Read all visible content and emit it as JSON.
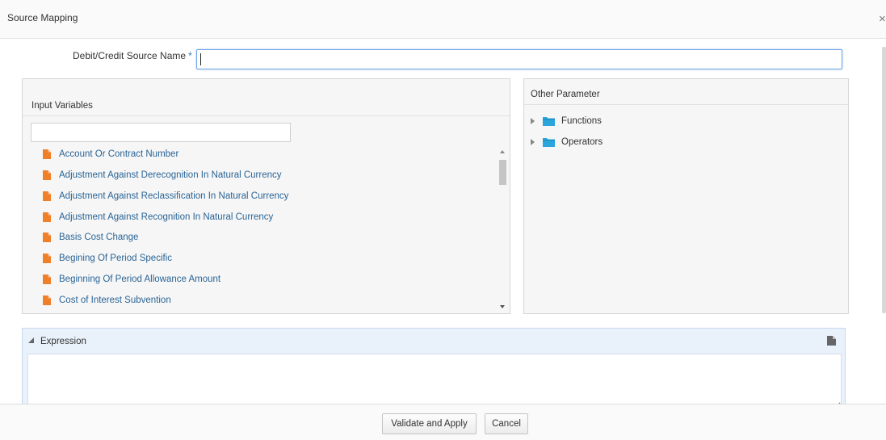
{
  "dialog": {
    "title": "Source Mapping",
    "close_glyph": "×"
  },
  "form": {
    "name_label": "Debit/Credit Source Name",
    "required_marker": "*",
    "name_value": ""
  },
  "input_variables": {
    "title": "Input Variables",
    "search_placeholder": "",
    "items": [
      {
        "label": "Account Or Contract Number",
        "icon": "file-icon"
      },
      {
        "label": "Adjustment Against Derecognition In Natural Currency",
        "icon": "file-icon"
      },
      {
        "label": "Adjustment Against Reclassification In Natural Currency",
        "icon": "file-icon"
      },
      {
        "label": "Adjustment Against Recognition In Natural Currency",
        "icon": "file-icon"
      },
      {
        "label": "Basis Cost Change",
        "icon": "file-icon"
      },
      {
        "label": "Begining Of Period Specific",
        "icon": "file-icon"
      },
      {
        "label": "Beginning Of Period Allowance Amount",
        "icon": "file-icon"
      },
      {
        "label": "Cost of Interest Subvention",
        "icon": "file-icon"
      }
    ]
  },
  "other_parameter": {
    "title": "Other Parameter",
    "nodes": [
      {
        "label": "Functions",
        "icon": "folder-icon"
      },
      {
        "label": "Operators",
        "icon": "folder-icon"
      }
    ]
  },
  "expression": {
    "title": "Expression",
    "value": ""
  },
  "footer": {
    "validate_label": "Validate and Apply",
    "cancel_label": "Cancel"
  },
  "colors": {
    "link_text": "#2a6496",
    "file_icon": "#f07f2a",
    "folder_icon": "#2ba6dd",
    "expression_header": "#e9f1fb",
    "focus_border": "#6ea6e8"
  }
}
